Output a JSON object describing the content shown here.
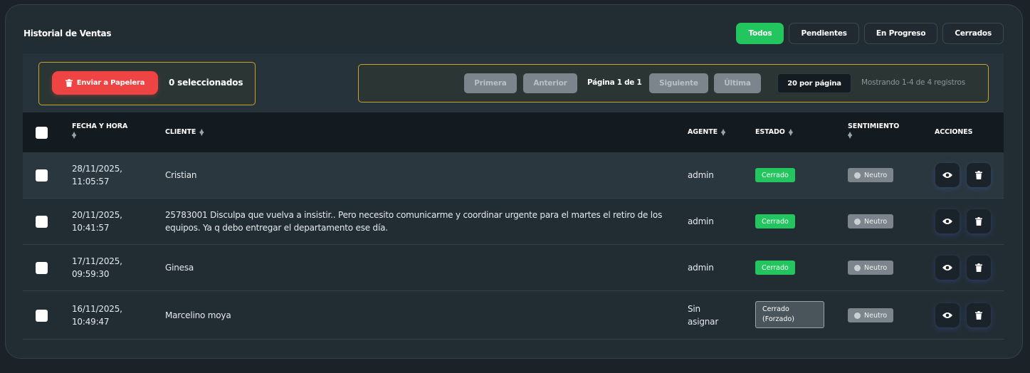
{
  "page": {
    "title": "Historial de Ventas"
  },
  "filters": [
    {
      "label": "Todos",
      "active": true
    },
    {
      "label": "Pendientes",
      "active": false
    },
    {
      "label": "En Progreso",
      "active": false
    },
    {
      "label": "Cerrados",
      "active": false
    }
  ],
  "bulk": {
    "trash_label": "Enviar a Papelera",
    "selected_count": "0 seleccionados"
  },
  "pager": {
    "first": "Primera",
    "prev": "Anterior",
    "page_label": "Página 1 de 1",
    "next": "Siguiente",
    "last": "Última",
    "per_page": "20 por página",
    "showing": "Mostrando 1-4 de 4 registros"
  },
  "table": {
    "headers": {
      "fecha": "FECHA Y HORA",
      "cliente": "CLIENTE",
      "agente": "AGENTE",
      "estado": "ESTADO",
      "sentimiento": "SENTIMIENTO",
      "acciones": "ACCIONES"
    },
    "rows": [
      {
        "date": "28/11/2025,",
        "time": "11:05:57",
        "client": "Cristian",
        "agent": "admin",
        "status": "Cerrado",
        "sentiment": "Neutro"
      },
      {
        "date": "20/11/2025,",
        "time": "10:41:57",
        "client": "25783001 Disculpa que vuelva a insistir.. Pero necesito comunicarme y coordinar urgente para el martes el retiro de los equipos. Ya q debo entregar el departamento ese día.",
        "agent": "admin",
        "status": "Cerrado",
        "sentiment": "Neutro"
      },
      {
        "date": "17/11/2025,",
        "time": "09:59:30",
        "client": "Ginesa",
        "agent": "admin",
        "status": "Cerrado",
        "sentiment": "Neutro"
      },
      {
        "date": "16/11/2025,",
        "time": "10:49:47",
        "client": "Marcelino moya",
        "agent": "Sin asignar",
        "status": "Cerrado (Forzado)",
        "sentiment": "Neutro"
      }
    ]
  },
  "colors": {
    "accent": "#22c55e",
    "danger": "#ef4444",
    "highlight_border": "#c9a227",
    "neutral": "#7b858b"
  },
  "icons": {
    "trash": "trash-icon",
    "view": "eye-icon",
    "sort": "sort-icon",
    "neutral": "neutral-face-icon"
  }
}
